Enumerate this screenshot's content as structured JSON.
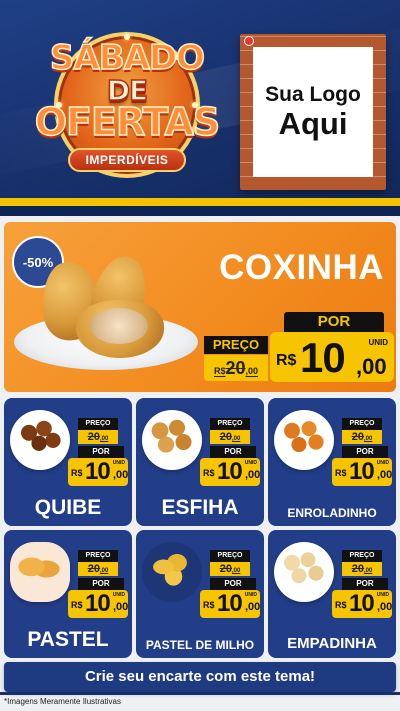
{
  "colors": {
    "navy": "#1f3f86",
    "orange": "#f28a1e",
    "yellow": "#f6c400",
    "card_blue": "#223e88"
  },
  "badge": {
    "line1": "SÁBADO",
    "line2": "DE",
    "line3": "OFERTAS",
    "ribbon": "IMPERDÍVEIS"
  },
  "logo": {
    "line1": "Sua Logo",
    "line2": "Aqui"
  },
  "hero": {
    "discount": "-50%",
    "title": "COXINHA",
    "old_label": "PREÇO",
    "old_price_main": "20",
    "old_price_cents": ",00",
    "old_price_currency": "R$",
    "new_label": "POR",
    "currency": "R$",
    "new_price_main": "10",
    "new_price_cents": ",00",
    "unit": "UNID"
  },
  "products": [
    {
      "name": "QUIBE",
      "old_label": "PREÇO",
      "old_main": "20",
      "old_cents": ",00",
      "new_label": "POR",
      "currency": "R$",
      "new_main": "10",
      "new_cents": ",00",
      "unit": "UNID",
      "icon": "quibe-image"
    },
    {
      "name": "ESFIHA",
      "old_label": "PREÇO",
      "old_main": "20",
      "old_cents": ",00",
      "new_label": "POR",
      "currency": "R$",
      "new_main": "10",
      "new_cents": ",00",
      "unit": "UNID",
      "icon": "esfiha-image"
    },
    {
      "name": "ENROLADINHO",
      "old_label": "PREÇO",
      "old_main": "20",
      "old_cents": ",00",
      "new_label": "POR",
      "currency": "R$",
      "new_main": "10",
      "new_cents": ",00",
      "unit": "UNID",
      "icon": "enroladinho-image"
    },
    {
      "name": "PASTEL",
      "old_label": "PREÇO",
      "old_main": "20",
      "old_cents": ",00",
      "new_label": "POR",
      "currency": "R$",
      "new_main": "10",
      "new_cents": ",00",
      "unit": "UNID",
      "icon": "pastel-image"
    },
    {
      "name": "PASTEL DE MILHO",
      "old_label": "PREÇO",
      "old_main": "20",
      "old_cents": ",00",
      "new_label": "POR",
      "currency": "R$",
      "new_main": "10",
      "new_cents": ",00",
      "unit": "UNID",
      "icon": "pastel-de-milho-image"
    },
    {
      "name": "EMPADINHA",
      "old_label": "PREÇO",
      "old_main": "20",
      "old_cents": ",00",
      "new_label": "POR",
      "currency": "R$",
      "new_main": "10",
      "new_cents": ",00",
      "unit": "UNID",
      "icon": "empadinha-image"
    }
  ],
  "cta": "Crie seu encarte com este tema!",
  "disclaimer": "*Imagens Meramente Ilustrativas"
}
